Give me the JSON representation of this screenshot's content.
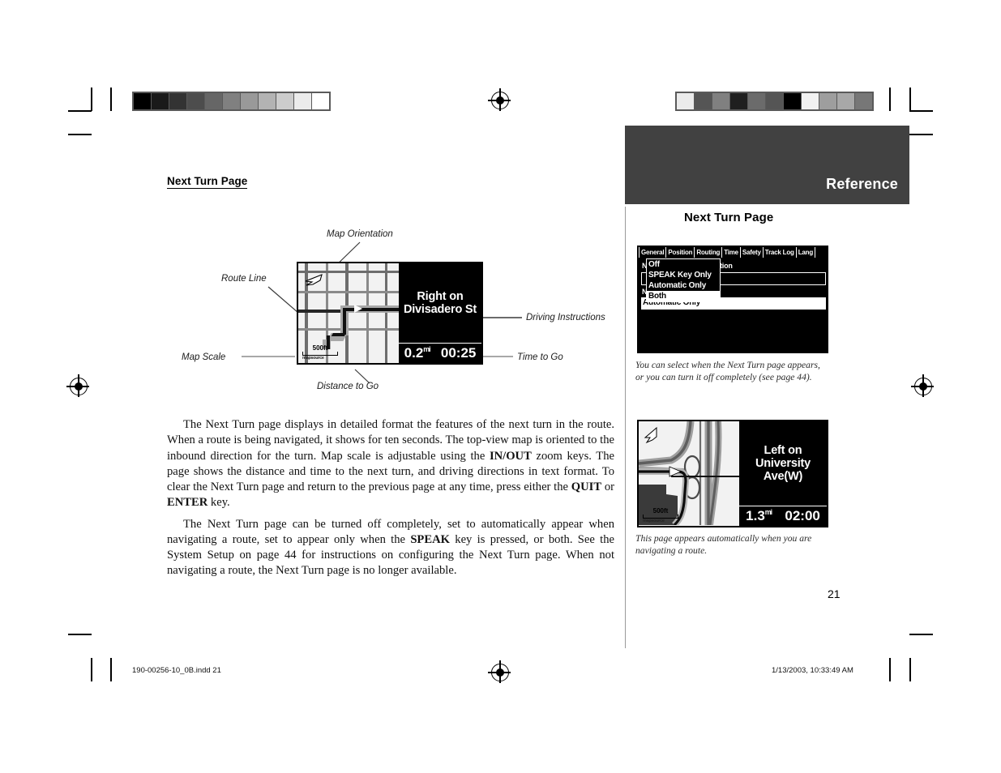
{
  "page": {
    "number": "21",
    "section_banner": "Reference",
    "section_subtitle": "Next Turn Page",
    "heading": "Next Turn Page"
  },
  "footer": {
    "file": "190-00256-10_0B.indd   21",
    "timestamp": "1/13/2003, 10:33:49 AM"
  },
  "calibration": {
    "left_bar": [
      "#000000",
      "#1a1a1a",
      "#333333",
      "#4d4d4d",
      "#666666",
      "#808080",
      "#999999",
      "#b3b3b3",
      "#cccccc",
      "#ebebeb",
      "#ffffff"
    ],
    "right_bar": [
      "#ebebeb",
      "#555555",
      "#808080",
      "#1f1f1f",
      "#6b6b6b",
      "#555555",
      "#000000",
      "#f2f2f2",
      "#9e9e9e",
      "#a8a8a8",
      "#777777"
    ]
  },
  "figure": {
    "callouts": [
      {
        "label": "Map Orientation"
      },
      {
        "label": "Route Line"
      },
      {
        "label": "Map Scale"
      },
      {
        "label": "Distance to Go"
      },
      {
        "label": "Driving Instructions"
      },
      {
        "label": "Time to Go"
      }
    ],
    "device": {
      "instruction_line1": "Right on",
      "instruction_line2": "Divisadero St",
      "distance": "0.2",
      "distance_unit": "mi",
      "time": "00:25",
      "map_scale": "500ft",
      "map_source": "mapsource"
    }
  },
  "body": {
    "paragraph1_parts": [
      {
        "text": "The Next Turn page displays in detailed format the features of the next turn in the route.  When a route is being navigated, it shows for ten seconds.  The top-view map is oriented to the inbound direction for the turn.  Map scale is adjustable using the ",
        "bold": false
      },
      {
        "text": "IN/OUT",
        "bold": true
      },
      {
        "text": " zoom keys.  The page shows the distance and time to the next turn, and driving directions in text format.  To clear the Next Turn page and return to the previous page at any time, press either the ",
        "bold": false
      },
      {
        "text": "QUIT",
        "bold": true
      },
      {
        "text": " or ",
        "bold": false
      },
      {
        "text": "ENTER",
        "bold": true
      },
      {
        "text": " key.",
        "bold": false
      }
    ],
    "paragraph2_parts": [
      {
        "text": "The Next Turn page can be turned off completely, set to automatically appear when navigating a route, set to appear only when the ",
        "bold": false
      },
      {
        "text": "SPEAK",
        "bold": true
      },
      {
        "text": " key is pressed, or both.  See the System Setup on page 44 for instructions on configuring the Next Turn page.  When not navigating a route, the Next Turn page is no longer available.",
        "bold": false
      }
    ]
  },
  "sidebar": {
    "setup_screen": {
      "tabs": [
        "General",
        "Position",
        "Routing",
        "Time",
        "Safety",
        "Track Log",
        "Lang"
      ],
      "dropdown_options": [
        "Off",
        "SPEAK Key Only",
        "Automatic Only",
        "Both"
      ],
      "dropdown_selected": "Both",
      "field_label": "Next Turn Page Declaration",
      "field_value": "Automatic Only"
    },
    "setup_caption": "You can select when the Next Turn page appears, or you can turn it off completely (see page 44).",
    "nav_screen": {
      "instruction_line1": "Left on",
      "instruction_line2": "University",
      "instruction_line3": "Ave(W)",
      "distance": "1.3",
      "distance_unit": "mi",
      "time": "02:00",
      "map_scale": "500ft",
      "map_source": "mapsource"
    },
    "nav_caption": "This page appears automatically when you are navigating a route."
  }
}
